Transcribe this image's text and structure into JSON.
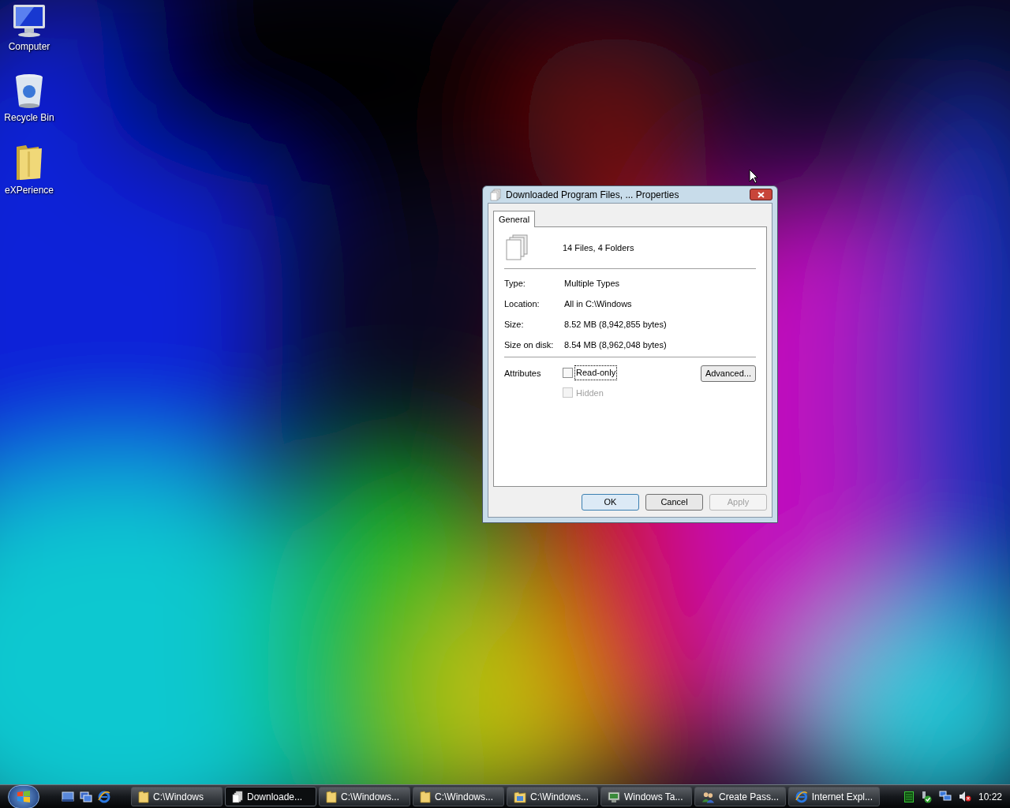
{
  "desktop_icons": [
    {
      "label": "Computer",
      "kind": "computer"
    },
    {
      "label": "Recycle Bin",
      "kind": "bin"
    },
    {
      "label": "eXPerience",
      "kind": "folder"
    }
  ],
  "dialog": {
    "title": "Downloaded Program Files, ... Properties",
    "tabs": [
      {
        "label": "General",
        "selected": true
      }
    ],
    "summary": "14 Files, 4 Folders",
    "properties": [
      {
        "label": "Type:",
        "value": "Multiple Types"
      },
      {
        "label": "Location:",
        "value": "All in C:\\Windows"
      },
      {
        "label": "Size:",
        "value": "8.52 MB (8,942,855 bytes)"
      },
      {
        "label": "Size on disk:",
        "value": "8.54 MB (8,962,048 bytes)"
      }
    ],
    "attributes_label": "Attributes",
    "attributes": [
      {
        "label": "Read-only",
        "checked": false,
        "disabled": false,
        "focused": true
      },
      {
        "label": "Hidden",
        "checked": false,
        "disabled": true,
        "focused": false
      }
    ],
    "advanced_button": "Advanced...",
    "buttons": [
      {
        "label": "OK",
        "default": true,
        "disabled": false
      },
      {
        "label": "Cancel",
        "default": false,
        "disabled": false
      },
      {
        "label": "Apply",
        "default": false,
        "disabled": true
      }
    ]
  },
  "taskbar": {
    "quick_launch": [
      {
        "kind": "desktop"
      },
      {
        "kind": "windows"
      },
      {
        "kind": "ie"
      }
    ],
    "buttons": [
      {
        "label": "C:\\Windows",
        "kind": "folder",
        "selected": false
      },
      {
        "label": "Downloade...",
        "kind": "files",
        "selected": true
      },
      {
        "label": "C:\\Windows...",
        "kind": "folder",
        "selected": false
      },
      {
        "label": "C:\\Windows...",
        "kind": "folder",
        "selected": false
      },
      {
        "label": "C:\\Windows...",
        "kind": "panel",
        "selected": false
      },
      {
        "label": "Windows Ta...",
        "kind": "monitor",
        "selected": false
      },
      {
        "label": "Create Pass...",
        "kind": "users",
        "selected": false
      },
      {
        "label": "Internet Expl...",
        "kind": "ie",
        "selected": false
      }
    ],
    "tray": [
      {
        "kind": "meter"
      },
      {
        "kind": "safe"
      },
      {
        "kind": "network"
      },
      {
        "kind": "muted"
      }
    ],
    "clock": "10:22"
  }
}
